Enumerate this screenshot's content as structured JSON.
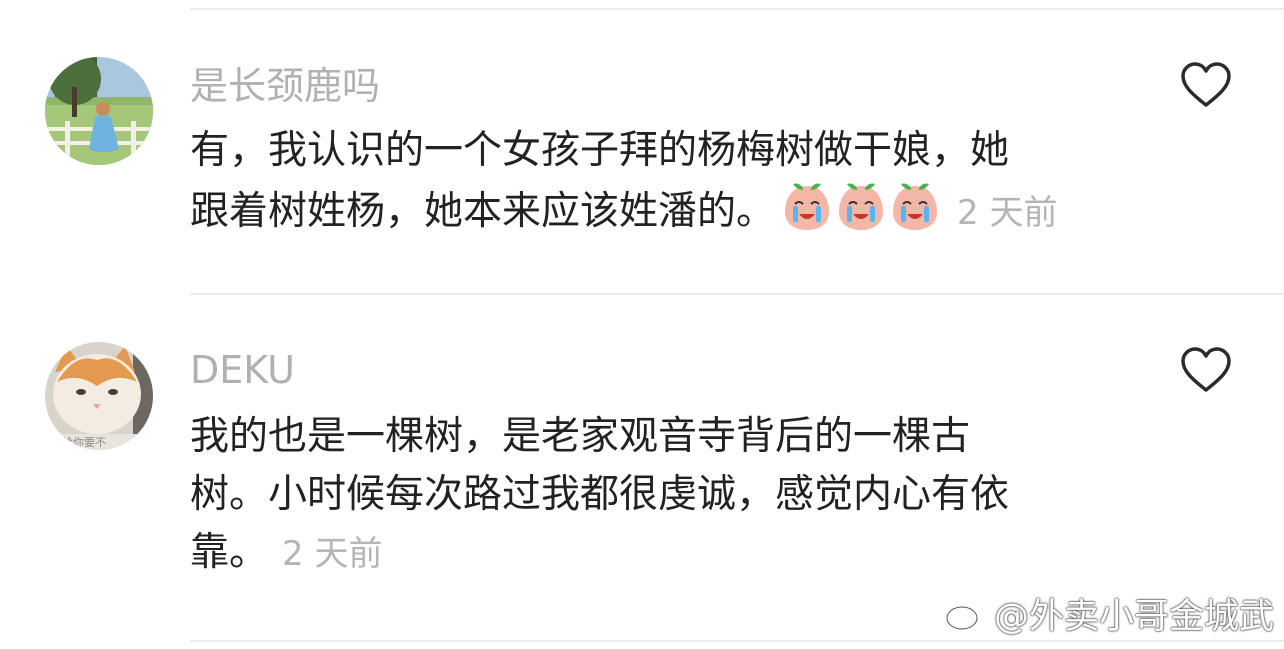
{
  "comments": [
    {
      "username": "是长颈鹿吗",
      "line1": "有，我认识的一个女孩子拜的杨梅树做干娘，她",
      "line2": "跟着树姓杨，她本来应该姓潘的。",
      "emoji_count": 3,
      "emoji_name": "crying-peach-emoji",
      "time": "2 天前",
      "like_icon": "heart-outline-icon",
      "avatar_desc": "girl-in-blue-dress-avatar"
    },
    {
      "username": "DEKU",
      "line1": "我的也是一棵树，是老家观音寺背后的一棵古",
      "line2": "树。小时候每次路过我都很虔诚，感觉内心有依",
      "line3": "靠。",
      "time": "2 天前",
      "like_icon": "heart-outline-icon",
      "avatar_desc": "orange-white-cat-avatar",
      "avatar_text": "气给你要不"
    }
  ],
  "watermark": {
    "text": "@外卖小哥金城武",
    "icon": "weibo-logo-icon"
  },
  "colors": {
    "username": "#b1b1b1",
    "body": "#222222",
    "time": "#b5b5b5",
    "divider": "#ececec"
  }
}
